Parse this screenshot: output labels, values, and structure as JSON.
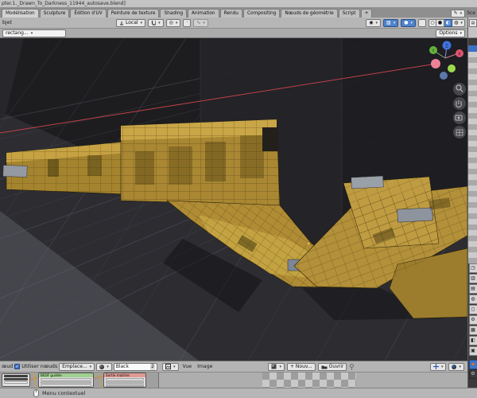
{
  "window": {
    "title": "pter.1._Drawn_To_Darkness_11944_autosave.blend]"
  },
  "workspace_tabs": {
    "tabs": [
      "Modélisation",
      "Sculpture",
      "Édition d'UV",
      "Peinture de texture",
      "Shading",
      "Animation",
      "Rendu",
      "Compositing",
      "Nœuds de géométrie",
      "Script"
    ],
    "add_label": "+",
    "scene_label": "Sce"
  },
  "viewport_header": {
    "mode_partial": "bjet",
    "orientation": "Local",
    "tool_partial": "rectang...",
    "options_label": "Options"
  },
  "gizmo": {
    "x": "X",
    "y": "Y",
    "z": "Z"
  },
  "properties": {
    "tab_icons": [
      "◳",
      "▥",
      "▤",
      "◍",
      "◻",
      "⚙",
      "▦",
      "◧",
      "▣"
    ]
  },
  "shader_editor": {
    "menu_partial": "œud",
    "use_nodes": "Utiliser nœuds",
    "check_glyph": "✓",
    "slot": "Emplace...",
    "datablock": "Black",
    "users": "2",
    "node1_title": "BSDF guidée",
    "node2_title": "Sortie matière"
  },
  "image_editor": {
    "menu_view": "Vue",
    "menu_image": "Image",
    "new_label": "+ Nouv...",
    "open_label": "Ouvrir"
  },
  "status_bar": {
    "hint": "Menu contextuel"
  },
  "colors": {
    "accent_blue": "#3f74c9",
    "mesh_tan": "#b08c35",
    "tracking_line_red": "#c24049",
    "axis_x": "#e0556f",
    "axis_y": "#67b33c",
    "axis_z": "#3f74dd"
  }
}
